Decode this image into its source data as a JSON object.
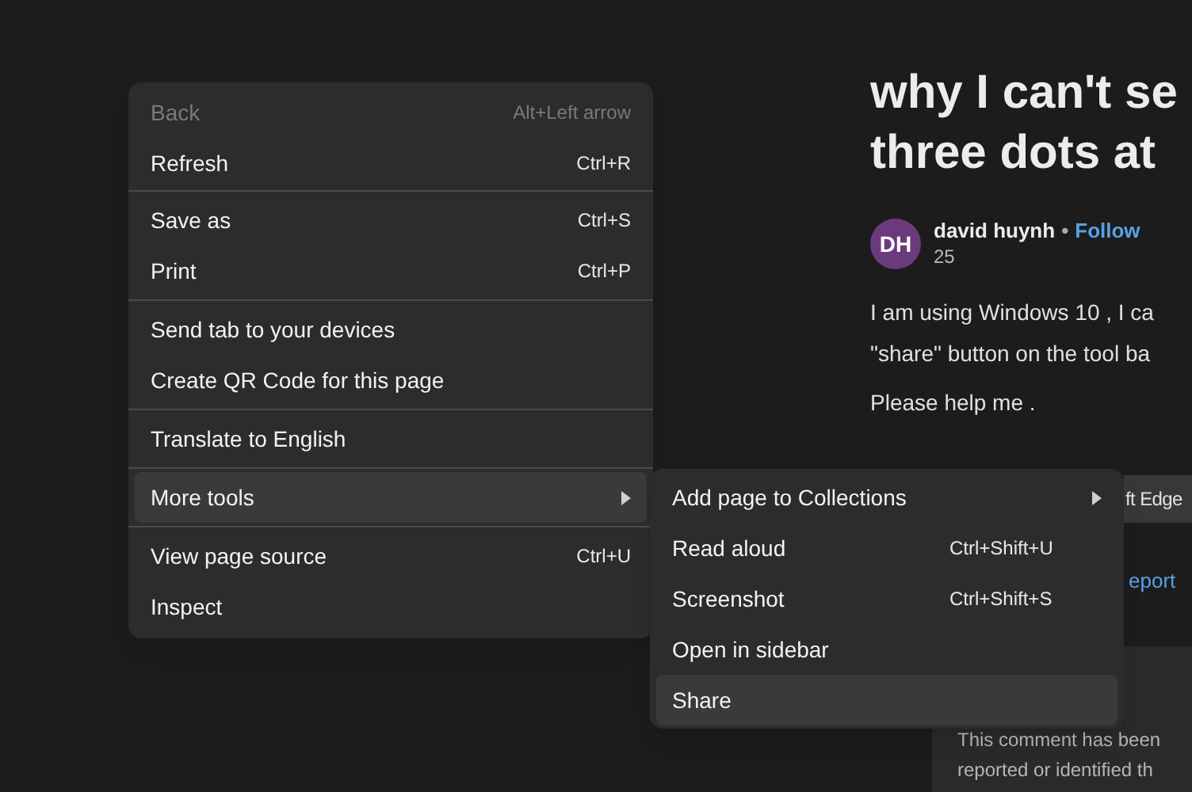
{
  "article": {
    "title_lines": [
      "why I can't se",
      "three dots at"
    ],
    "author": {
      "initials": "DH",
      "name": "david huynh",
      "separator": "•",
      "follow": "Follow",
      "count": "25"
    },
    "body_lines": [
      "I am using Windows 10 , I ca",
      "\"share\" button on the tool ba"
    ],
    "request": "Please help me .",
    "edge_button": "ft Edge",
    "report_link": "eport",
    "comment_notice": [
      "This comment has been",
      "reported or identified th"
    ]
  },
  "context_menu": {
    "groups": [
      [
        {
          "label": "Back",
          "shortcut": "Alt+Left arrow",
          "disabled": true,
          "selected": false,
          "kind": "item"
        },
        {
          "label": "Refresh",
          "shortcut": "Ctrl+R",
          "disabled": false,
          "selected": false,
          "kind": "item"
        }
      ],
      [
        {
          "label": "Save as",
          "shortcut": "Ctrl+S",
          "disabled": false,
          "selected": false,
          "kind": "item"
        },
        {
          "label": "Print",
          "shortcut": "Ctrl+P",
          "disabled": false,
          "selected": false,
          "kind": "item"
        }
      ],
      [
        {
          "label": "Send tab to your devices",
          "disabled": false,
          "selected": false,
          "kind": "item"
        },
        {
          "label": "Create QR Code for this page",
          "disabled": false,
          "selected": false,
          "kind": "item"
        }
      ],
      [
        {
          "label": "Translate to English",
          "disabled": false,
          "selected": false,
          "kind": "item"
        }
      ],
      [
        {
          "label": "More tools",
          "disabled": false,
          "selected": true,
          "kind": "submenu"
        }
      ],
      [
        {
          "label": "View page source",
          "shortcut": "Ctrl+U",
          "disabled": false,
          "selected": false,
          "kind": "item"
        },
        {
          "label": "Inspect",
          "disabled": false,
          "selected": false,
          "kind": "item"
        }
      ]
    ]
  },
  "submenu": {
    "items": [
      {
        "label": "Add page to Collections",
        "disabled": false,
        "selected": false,
        "kind": "submenu"
      },
      {
        "label": "Read aloud",
        "shortcut": "Ctrl+Shift+U",
        "disabled": false,
        "selected": false,
        "kind": "item"
      },
      {
        "label": "Screenshot",
        "shortcut": "Ctrl+Shift+S",
        "disabled": false,
        "selected": false,
        "kind": "item"
      },
      {
        "label": "Open in sidebar",
        "disabled": false,
        "selected": false,
        "kind": "item"
      },
      {
        "label": "Share",
        "disabled": false,
        "selected": true,
        "kind": "item"
      }
    ]
  }
}
